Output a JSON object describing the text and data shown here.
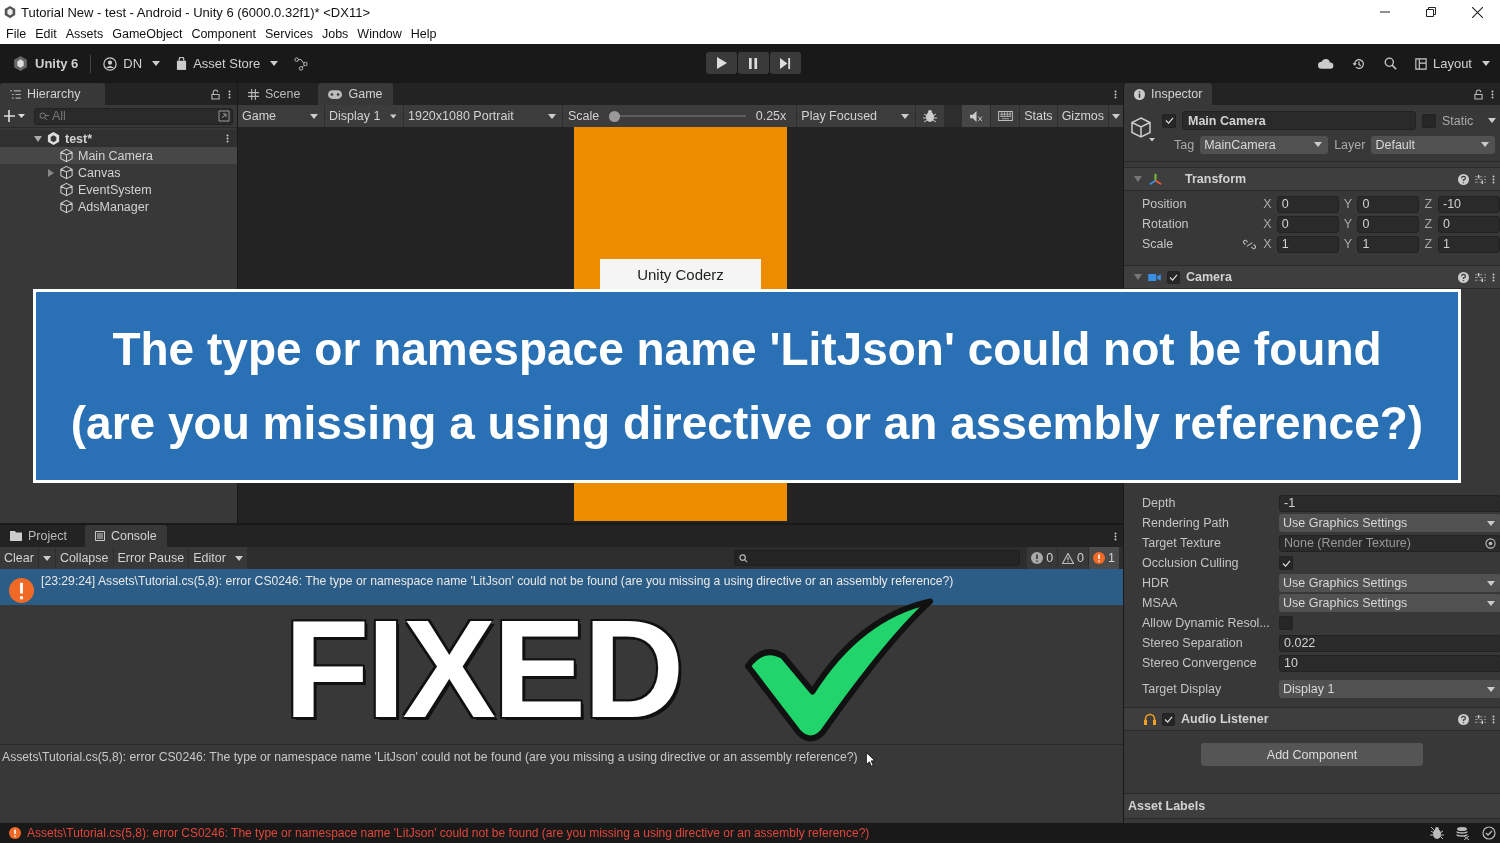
{
  "window": {
    "title": "Tutorial New - test - Android - Unity 6 (6000.0.32f1)* <DX11>"
  },
  "menu": [
    "File",
    "Edit",
    "Assets",
    "GameObject",
    "Component",
    "Services",
    "Jobs",
    "Window",
    "Help"
  ],
  "toolbar": {
    "product": "Unity 6",
    "account": "DN",
    "asset_store": "Asset Store",
    "layout": "Layout"
  },
  "hierarchy": {
    "tab": "Hierarchy",
    "search_placeholder": "All",
    "scene": {
      "name": "test*",
      "expanded": true,
      "children": [
        {
          "name": "Main Camera",
          "selected": true,
          "expandable": false
        },
        {
          "name": "Canvas",
          "selected": false,
          "expandable": true
        },
        {
          "name": "EventSystem",
          "selected": false,
          "expandable": false
        },
        {
          "name": "AdsManager",
          "selected": false,
          "expandable": false
        }
      ]
    }
  },
  "view_tabs": [
    {
      "kind": "scene",
      "label": "Scene",
      "selected": false
    },
    {
      "kind": "game",
      "label": "Game",
      "selected": true
    }
  ],
  "game_toolbar": {
    "view": "Game",
    "display": "Display 1",
    "resolution": "1920x1080 Portrait",
    "scale_label": "Scale",
    "scale": {
      "level": 0
    },
    "scale_reading": "0.25x",
    "play_mode": "Play Focused",
    "stats": "Stats",
    "gizmos": "Gizmos"
  },
  "game_view": {
    "button": "Unity Coderz"
  },
  "inspector": {
    "tab": "Inspector",
    "object": {
      "name": "Main Camera",
      "active": true,
      "static": false,
      "static_label": "Static",
      "tag_label": "Tag",
      "tag": "MainCamera",
      "layer_label": "Layer",
      "layer": "Default"
    },
    "transform": {
      "title": "Transform",
      "rows": [
        {
          "label": "Position",
          "linked": false,
          "values": [
            {
              "axis": "X",
              "value": "0"
            },
            {
              "axis": "Y",
              "value": "0"
            },
            {
              "axis": "Z",
              "value": "-10"
            }
          ]
        },
        {
          "label": "Rotation",
          "linked": false,
          "values": [
            {
              "axis": "X",
              "value": "0"
            },
            {
              "axis": "Y",
              "value": "0"
            },
            {
              "axis": "Z",
              "value": "0"
            }
          ]
        },
        {
          "label": "Scale",
          "linked": true,
          "values": [
            {
              "axis": "X",
              "value": "1"
            },
            {
              "axis": "Y",
              "value": "1"
            },
            {
              "axis": "Z",
              "value": "1"
            }
          ]
        }
      ]
    },
    "camera": {
      "title": "Camera",
      "enabled": true,
      "rows": [
        {
          "kind": "field",
          "label": "Depth",
          "value": "-1"
        },
        {
          "kind": "dropdown",
          "label": "Rendering Path",
          "value": "Use Graphics Settings"
        },
        {
          "kind": "object",
          "label": "Target Texture",
          "value": "None (Render Texture)"
        },
        {
          "kind": "checkbox",
          "label": "Occlusion Culling",
          "checked": true
        },
        {
          "kind": "dropdown",
          "label": "HDR",
          "value": "Use Graphics Settings"
        },
        {
          "kind": "dropdown",
          "label": "MSAA",
          "value": "Use Graphics Settings"
        },
        {
          "kind": "checkbox",
          "label": "Allow Dynamic Resol...",
          "checked": false
        },
        {
          "kind": "field",
          "label": "Stereo Separation",
          "value": "0.022"
        },
        {
          "kind": "field",
          "label": "Stereo Convergence",
          "value": "10"
        },
        {
          "kind": "dropdown",
          "label": "Target Display",
          "value": "Display 1"
        }
      ]
    },
    "audio": {
      "title": "Audio Listener",
      "enabled": true
    },
    "add_component": "Add Component",
    "asset_labels": "Asset Labels"
  },
  "console": {
    "tabs": [
      {
        "kind": "project",
        "label": "Project",
        "selected": false
      },
      {
        "kind": "console",
        "label": "Console",
        "selected": true
      }
    ],
    "buttons": [
      {
        "kind": "split",
        "label": "Clear"
      },
      {
        "kind": "button",
        "label": "Collapse"
      },
      {
        "kind": "button",
        "label": "Error Pause"
      },
      {
        "kind": "dropdown",
        "label": "Editor"
      }
    ],
    "counts": [
      {
        "kind": "info",
        "count": "0"
      },
      {
        "kind": "warning",
        "count": "0"
      },
      {
        "kind": "error",
        "count": "1"
      }
    ],
    "entries": [
      {
        "kind": "error",
        "selected": true,
        "text": "[23:29:24] Assets\\Tutorial.cs(5,8): error CS0246: The type or namespace name 'LitJson' could not be found (are you missing a using directive or an assembly reference?)"
      }
    ],
    "detail": "Assets\\Tutorial.cs(5,8): error CS0246: The type or namespace name 'LitJson' could not be found (are you missing a using directive or an assembly reference?)"
  },
  "status_bar": {
    "kind": "error",
    "message": "Assets\\Tutorial.cs(5,8): error CS0246: The type or namespace name 'LitJson' could not be found (are you missing a using directive or an assembly reference?)"
  },
  "overlay": {
    "banner": [
      "The type or namespace name 'LitJson' could not be found",
      "(are you missing a using directive or an assembly reference?)"
    ],
    "stamp": "FIXED"
  }
}
